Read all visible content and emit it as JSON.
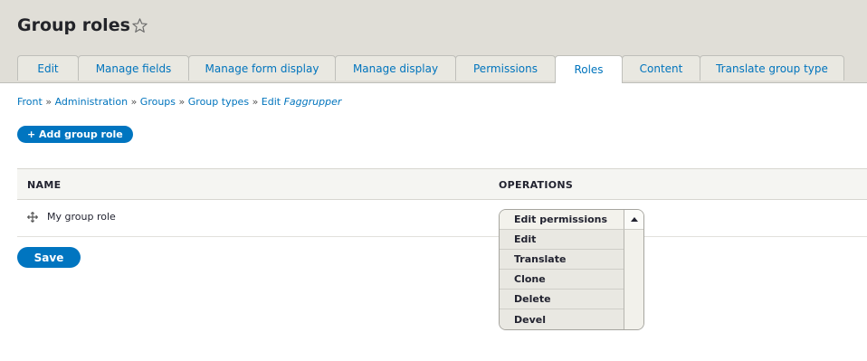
{
  "page": {
    "title": "Group roles"
  },
  "tabs": [
    {
      "label": "Edit",
      "active": false
    },
    {
      "label": "Manage fields",
      "active": false
    },
    {
      "label": "Manage form display",
      "active": false
    },
    {
      "label": "Manage display",
      "active": false
    },
    {
      "label": "Permissions",
      "active": false
    },
    {
      "label": "Roles",
      "active": true
    },
    {
      "label": "Content",
      "active": false
    },
    {
      "label": "Translate group type",
      "active": false
    }
  ],
  "breadcrumb": {
    "items": [
      "Front",
      "Administration",
      "Groups",
      "Group types"
    ],
    "separator": "»",
    "last_prefix": "Edit",
    "last_emphasis": "Faggrupper"
  },
  "actions": {
    "add_role": "+ Add group role"
  },
  "table": {
    "headers": {
      "name": "NAME",
      "operations": "OPERATIONS"
    },
    "rows": [
      {
        "name": "My group role"
      }
    ]
  },
  "operations": {
    "primary": "Edit permissions",
    "items": [
      "Edit",
      "Translate",
      "Clone",
      "Delete",
      "Devel"
    ]
  },
  "form": {
    "save_label": "Save"
  },
  "colors": {
    "accent": "#0075c0",
    "header_bg": "#e0ded7",
    "link": "#0074bd"
  }
}
